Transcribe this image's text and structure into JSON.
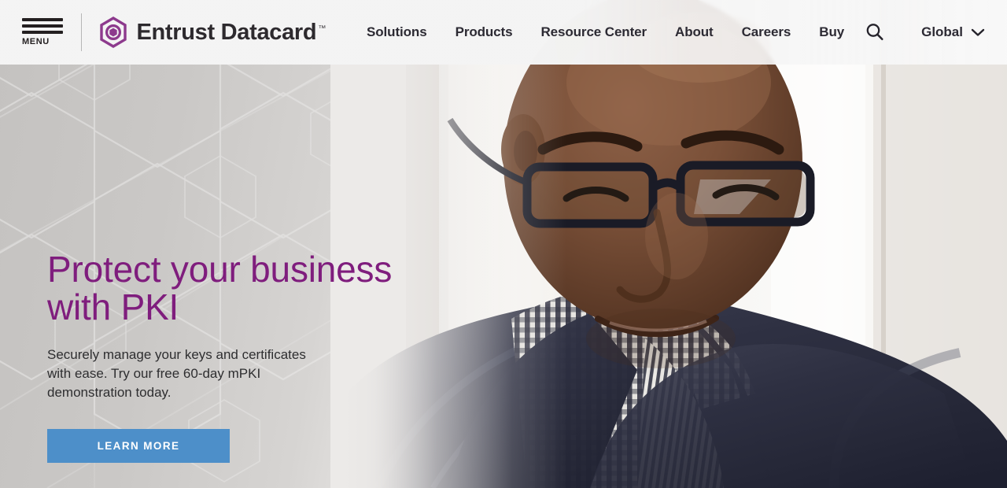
{
  "header": {
    "menu": {
      "label": "MENU",
      "icon": "hamburger-icon"
    },
    "brand": {
      "name": "Entrust Datacard",
      "trademark": "™",
      "mark_color": "#8d3a8d"
    },
    "nav": [
      {
        "label": "Solutions"
      },
      {
        "label": "Products"
      },
      {
        "label": "Resource Center"
      },
      {
        "label": "About"
      },
      {
        "label": "Careers"
      },
      {
        "label": "Buy"
      }
    ],
    "search": {
      "icon": "search-icon"
    },
    "region": {
      "label": "Global",
      "icon": "chevron-down-icon"
    }
  },
  "hero": {
    "title": "Protect your business\nwith PKI",
    "subtitle": "Securely manage your keys and certificates\nwith ease. Try our free 60-day mPKI\ndemonstration today.",
    "cta_label": "LEARN MORE",
    "title_color": "#7f1d7d",
    "cta_color": "#4d8fc9",
    "background_color": "#c9c7c5",
    "photo_alt": "Man with glasses wearing a navy sweater over a checkered shirt, looking down"
  }
}
